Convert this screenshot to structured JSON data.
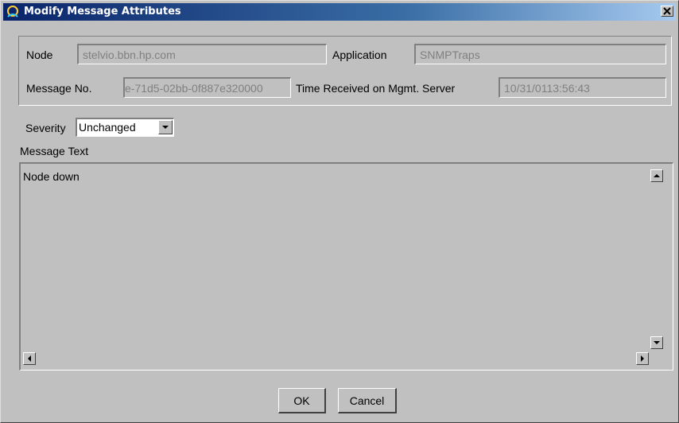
{
  "window": {
    "title": "Modify Message Attributes",
    "close_glyph": "✕"
  },
  "details": {
    "node_label": "Node",
    "node_value": "stelvio.bbn.hp.com",
    "application_label": "Application",
    "application_value": "SNMPTraps",
    "message_no_label": "Message No.",
    "message_no_value": "e-71d5-02bb-0f887e320000",
    "time_received_label": "Time Received on Mgmt. Server",
    "time_received_value": "10/31/0113:56:43"
  },
  "severity": {
    "label": "Severity",
    "selected": "Unchanged"
  },
  "message_text": {
    "label": "Message Text",
    "value": "Node down"
  },
  "buttons": {
    "ok": "OK",
    "cancel": "Cancel"
  },
  "colors": {
    "title_gradient_start": "#0a246a",
    "title_gradient_end": "#a6caf0",
    "face": "#c0c0c0",
    "disabled_text": "#808080"
  }
}
